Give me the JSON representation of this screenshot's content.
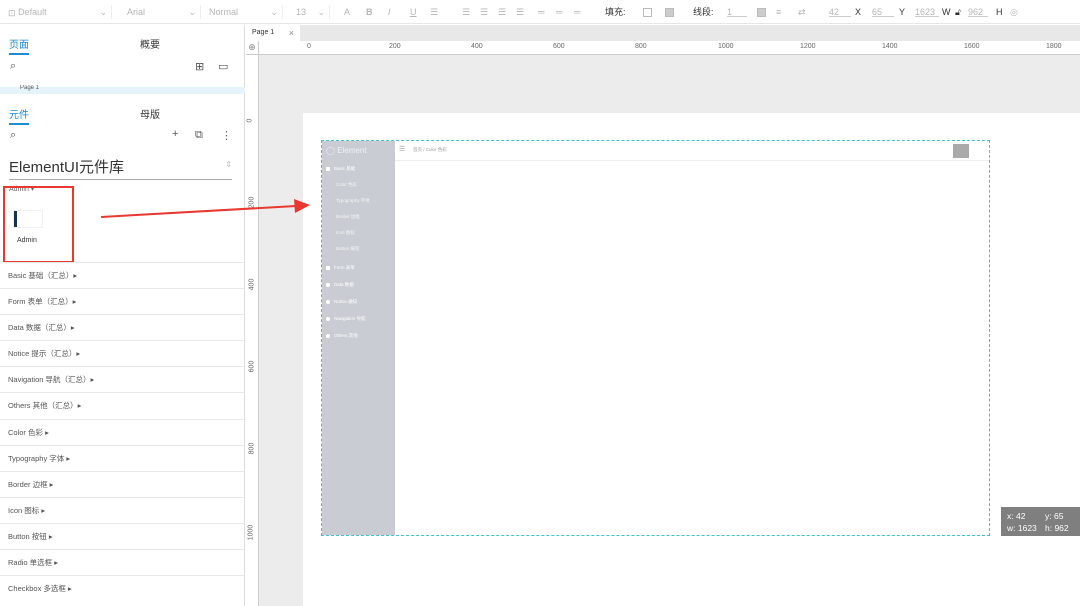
{
  "toolbar": {
    "style": "Default",
    "font_family": "Arial",
    "font_weight": "Normal",
    "font_size": "13",
    "fill_label": "填充:",
    "line_label": "线段:",
    "line_width": "1",
    "x_label": "X",
    "x": "42",
    "y_label": "Y",
    "y": "65",
    "w_label": "W",
    "w": "1623",
    "h_label": "H",
    "h": "962",
    "icons": [
      "chevron-down-icon",
      "text-color-icon",
      "bold-icon",
      "italic-icon",
      "underline-icon",
      "bullet-list-icon",
      "align-left-icon",
      "align-center-icon",
      "align-right-icon",
      "justify-icon",
      "valign-top-icon",
      "valign-middle-icon",
      "valign-bottom-icon",
      "fill-color-icon",
      "fill-image-icon",
      "line-color-icon",
      "line-style-icon",
      "arrow-style-icon",
      "lock-icon",
      "eye-icon"
    ]
  },
  "pages_panel": {
    "tab_active": "页面",
    "tab_other": "概要",
    "page_item": "Page 1"
  },
  "library_panel": {
    "tab_active": "元件",
    "tab_other": "母版",
    "library_name": "ElementUI元件库",
    "group_admin": "Admin ▾",
    "admin_widget": "Admin",
    "groups": [
      "Basic 基础（汇总）▸",
      "Form 表单（汇总）▸",
      "Data 数据（汇总）▸",
      "Notice 提示（汇总）▸",
      "Navigation 导航（汇总）▸",
      "Others 其他（汇总）▸",
      "Color 色彩 ▸",
      "Typography 字体 ▸",
      "Border 边框 ▸",
      "Icon 图标 ▸",
      "Button 按钮 ▸",
      "Radio 单选框 ▸",
      "Checkbox 多选框 ▸"
    ]
  },
  "editor": {
    "page_tab": "Page 1",
    "ruler_h": [
      "0",
      "200",
      "400",
      "600",
      "800",
      "1000",
      "1200",
      "1400",
      "1600",
      "1800"
    ],
    "ruler_v": [
      "0",
      "200",
      "400",
      "600",
      "800",
      "1000"
    ]
  },
  "widget": {
    "brand": "Element",
    "breadcrumb": "首页 / Color 色彩",
    "menu": [
      {
        "label": "Basic 基础",
        "sub": [
          "Color 色彩",
          "Typography 字体",
          "Border 边框",
          "Icon 图标",
          "Button 按钮"
        ]
      },
      {
        "label": "Form 表单",
        "sub": []
      },
      {
        "label": "Data 数据",
        "sub": []
      },
      {
        "label": "Notice 通知",
        "sub": []
      },
      {
        "label": "Navigation 导航",
        "sub": []
      },
      {
        "label": "Others 其他",
        "sub": []
      }
    ]
  },
  "coords_box": {
    "x": "x: 42",
    "y": "y: 65",
    "w": "w: 1623",
    "h": "h: 962"
  },
  "colors": {
    "accent": "#1e8bd2",
    "highlight_border": "#e8382f",
    "arrow": "#e8382f",
    "selection": "#39c5cf",
    "sidebar": "#c9cdd3"
  }
}
